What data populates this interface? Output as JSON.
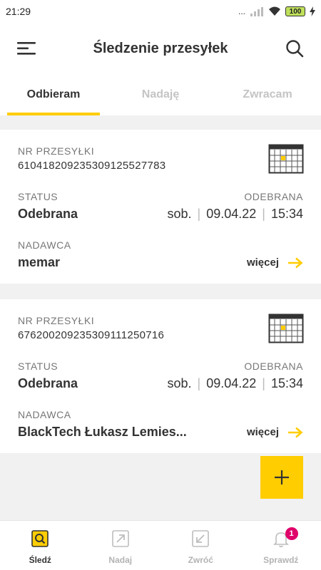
{
  "status_bar": {
    "time": "21:29",
    "signal_text": "...",
    "battery": "100"
  },
  "header": {
    "title": "Śledzenie przesyłek"
  },
  "tabs": [
    {
      "label": "Odbieram",
      "active": true
    },
    {
      "label": "Nadaję",
      "active": false
    },
    {
      "label": "Zwracam",
      "active": false
    }
  ],
  "shipments": [
    {
      "number_label": "NR PRZESYŁKI",
      "number": "610418209235309125527783",
      "status_label": "STATUS",
      "status_right_label": "ODEBRANA",
      "status": "Odebrana",
      "day": "sob.",
      "date": "09.04.22",
      "time": "15:34",
      "sender_label": "NADAWCA",
      "sender": "memar",
      "more": "więcej"
    },
    {
      "number_label": "NR PRZESYŁKI",
      "number": "676200209235309111250716",
      "status_label": "STATUS",
      "status_right_label": "ODEBRANA",
      "status": "Odebrana",
      "day": "sob.",
      "date": "09.04.22",
      "time": "15:34",
      "sender_label": "NADAWCA",
      "sender": "BlackTech Łukasz Lemies...",
      "more": "więcej"
    }
  ],
  "bottom_nav": [
    {
      "label": "Śledź",
      "icon": "track-icon",
      "active": true
    },
    {
      "label": "Nadaj",
      "icon": "send-icon",
      "active": false
    },
    {
      "label": "Zwróć",
      "icon": "return-icon",
      "active": false
    },
    {
      "label": "Sprawdź",
      "icon": "bell-icon",
      "active": false,
      "badge": "1"
    }
  ],
  "colors": {
    "accent": "#ffcd00",
    "badge": "#e0006a",
    "background": "#f1f1f1"
  }
}
